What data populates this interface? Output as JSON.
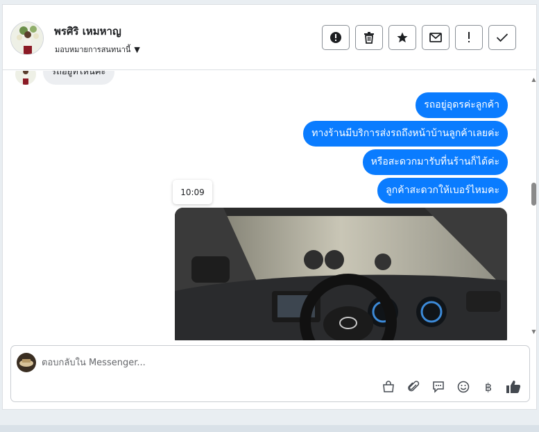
{
  "header": {
    "contact_name": "พรศิริ เหมหาญ",
    "assignment_label": "มอบหมายการสนทนานี้",
    "actions": [
      {
        "icon": "alert-circle-icon",
        "name": "mark-spam-button"
      },
      {
        "icon": "trash-icon",
        "name": "delete-button"
      },
      {
        "icon": "star-icon",
        "name": "star-button"
      },
      {
        "icon": "mail-icon",
        "name": "mark-unread-button"
      },
      {
        "icon": "exclamation-icon",
        "name": "follow-up-button"
      },
      {
        "icon": "check-icon",
        "name": "mark-done-button"
      }
    ]
  },
  "thread": {
    "previous_message_partial": "รถอยู่ที่ไหนคะ",
    "outgoing_messages": [
      "รถอยู่อุดรค่ะลูกค้า",
      "ทางร้านมีบริการส่งรถถึงหน้าบ้านลูกค้าเลยค่ะ",
      "หรือสะดวกมารับที่นร้านก็ได้ค่ะ",
      "ลูกค้าสะดวกให้เบอร์ไหมคะ"
    ],
    "timestamp": "10:09",
    "attachment": "car-interior-photo"
  },
  "composer": {
    "placeholder": "ตอบกลับใน Messenger...",
    "tools": [
      "shopping-bag-icon",
      "paperclip-icon",
      "saved-reply-icon",
      "emoji-icon",
      "baht-icon",
      "thumbs-up-icon"
    ],
    "baht_symbol": "฿"
  },
  "colors": {
    "outgoing_bubble": "#0a7cff",
    "outgoing_text": "#ffffff",
    "incoming_bubble": "#eceef1"
  }
}
